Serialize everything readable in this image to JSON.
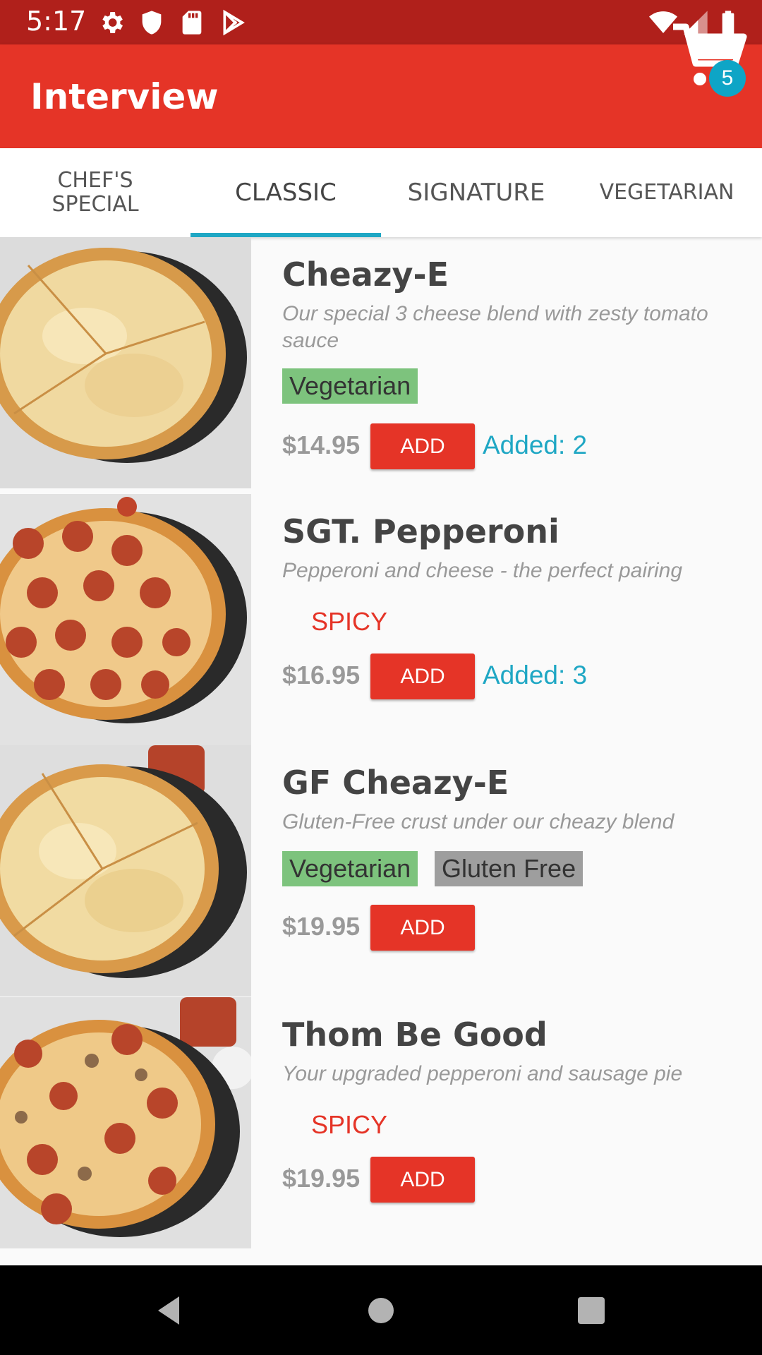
{
  "status_bar": {
    "time": "5:17",
    "icons": [
      "gear-icon",
      "shield-icon",
      "sd-card-icon",
      "play-store-icon",
      "wifi-icon",
      "signal-icon",
      "battery-icon"
    ]
  },
  "app_bar": {
    "title": "Interview",
    "cart_count": "5",
    "color": "#e53427"
  },
  "tabs": [
    {
      "label": "CHEF'S\nSPECIAL",
      "active": false
    },
    {
      "label": "CLASSIC",
      "active": true
    },
    {
      "label": "SIGNATURE",
      "active": false
    },
    {
      "label": "VEGETARIAN",
      "active": false
    }
  ],
  "items": [
    {
      "title": "Cheazy-E",
      "description": "Our special 3 cheese blend with zesty tomato sauce",
      "tags": [
        "Vegetarian"
      ],
      "spicy": "",
      "price": "$14.95",
      "add_label": "ADD",
      "added": "Added: 2"
    },
    {
      "title": "SGT. Pepperoni",
      "description": "Pepperoni and cheese - the perfect pairing",
      "tags": [],
      "spicy": "SPICY",
      "price": "$16.95",
      "add_label": "ADD",
      "added": "Added: 3"
    },
    {
      "title": "GF Cheazy-E",
      "description": "Gluten-Free crust under our cheazy blend",
      "tags": [
        "Vegetarian",
        "Gluten Free"
      ],
      "spicy": "",
      "price": "$19.95",
      "add_label": "ADD",
      "added": ""
    },
    {
      "title": "Thom Be Good",
      "description": "Your upgraded pepperoni and sausage pie",
      "tags": [],
      "spicy": "SPICY",
      "price": "$19.95",
      "add_label": "ADD",
      "added": ""
    }
  ],
  "colors": {
    "primary": "#e53427",
    "primary_dark": "#b0201b",
    "accent": "#1fa7c4",
    "vegetarian_tag": "#7dc37d",
    "gluten_free_tag": "#9e9e9e"
  }
}
